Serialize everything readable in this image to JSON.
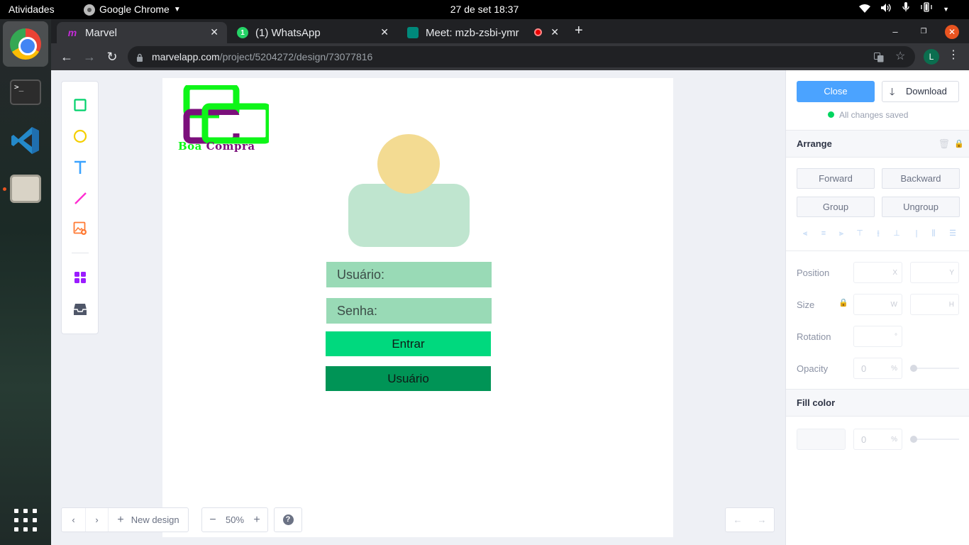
{
  "topbar": {
    "activities": "Atividades",
    "app_name": "Google Chrome",
    "clock": "27 de set  18:37"
  },
  "dock": {
    "apps": [
      "chrome-icon",
      "terminal-icon",
      "vscode-icon",
      "files-icon"
    ],
    "terminal_glyph": ">_"
  },
  "tabs": [
    {
      "title": "Marvel"
    },
    {
      "title": "(1) WhatsApp",
      "badge": "1"
    },
    {
      "title": "Meet: mzb-zsbi-ymr"
    }
  ],
  "omnibox": {
    "host": "marvelapp.com",
    "path": "/project/5204272/design/73077816"
  },
  "profile_initial": "L",
  "design": {
    "logo_word1": "Boa",
    "logo_word2": "Compra",
    "username_placeholder": "Usuário:",
    "password_placeholder": "Senha:",
    "login_button": "Entrar",
    "user_button": "Usuário"
  },
  "bottom": {
    "new_design": "New design",
    "zoom": "50%",
    "help": "?"
  },
  "inspector": {
    "close": "Close",
    "download": "Download",
    "saved_status": "All changes saved",
    "arrange_title": "Arrange",
    "forward": "Forward",
    "backward": "Backward",
    "group": "Group",
    "ungroup": "Ungroup",
    "position_label": "Position",
    "size_label": "Size",
    "rotation_label": "Rotation",
    "opacity_label": "Opacity",
    "fill_title": "Fill color",
    "x_suffix": "X",
    "y_suffix": "Y",
    "w_suffix": "W",
    "h_suffix": "H",
    "deg_suffix": "°",
    "pct_suffix": "%",
    "opacity_value": "0",
    "fill_opacity_value": "0"
  },
  "colors": {
    "accent": "#4ba3ff",
    "saved_dot": "#00d55f",
    "login_button": "#00d97e",
    "user_button": "#009456",
    "field_bg": "#99dab6",
    "avatar_head": "#f3db92",
    "avatar_body": "#bfe5cf"
  }
}
